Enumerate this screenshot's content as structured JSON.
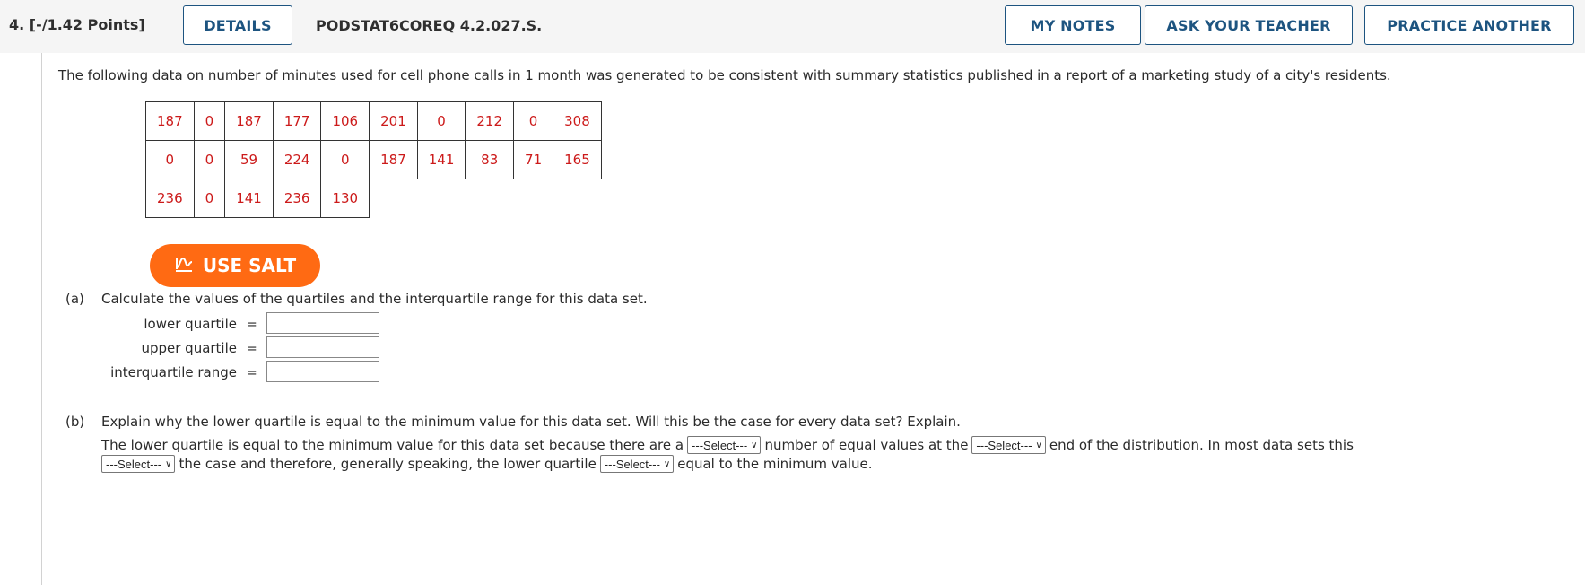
{
  "header": {
    "question_number": "4.  [-/1.42 Points]",
    "details_label": "DETAILS",
    "question_code": "PODSTAT6COREQ 4.2.027.S.",
    "my_notes_label": "MY NOTES",
    "ask_teacher_label": "ASK YOUR TEACHER",
    "practice_label": "PRACTICE ANOTHER"
  },
  "intro": "The following data on number of minutes used for cell phone calls in 1 month was generated to be consistent with summary statistics published in a report of a marketing study of a city's residents.",
  "data_table": {
    "rows": [
      [
        "187",
        "0",
        "187",
        "177",
        "106",
        "201",
        "0",
        "212",
        "0",
        "308"
      ],
      [
        "0",
        "0",
        "59",
        "224",
        "0",
        "187",
        "141",
        "83",
        "71",
        "165"
      ],
      [
        "236",
        "0",
        "141",
        "236",
        "130"
      ]
    ]
  },
  "salt_button": {
    "label": "USE SALT",
    "icon": "salt-chart-icon"
  },
  "part_a": {
    "label": "(a)",
    "prompt": "Calculate the values of the quartiles and the interquartile range for this data set.",
    "fields": [
      {
        "label": "lower quartile",
        "value": ""
      },
      {
        "label": "upper quartile",
        "value": ""
      },
      {
        "label": "interquartile range",
        "value": ""
      }
    ],
    "equals": "="
  },
  "part_b": {
    "label": "(b)",
    "prompt": "Explain why the lower quartile is equal to the minimum value for this data set. Will this be the case for every data set? Explain.",
    "line1": {
      "t1": "The lower quartile is equal to the minimum value for this data set because there are a",
      "t2": "number of equal values at the",
      "t3": "end of the distribution. In most data sets this"
    },
    "line2": {
      "t1": "the case and therefore, generally speaking, the lower quartile",
      "t2": "equal to the minimum value."
    },
    "select_placeholder": "---Select---"
  },
  "colors": {
    "button_border": "#1d5480",
    "data_value": "#cc1a1a",
    "salt_orange": "#ff6a13",
    "header_bg": "#f5f5f5"
  }
}
